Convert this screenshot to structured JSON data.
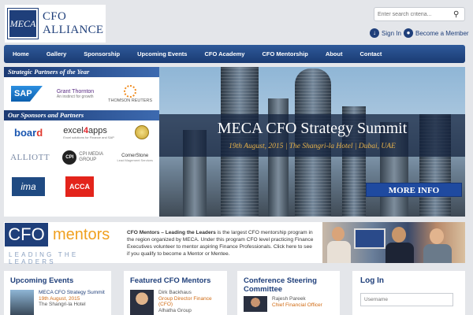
{
  "header": {
    "logo_mark": "MECA",
    "logo_line1": "CFO",
    "logo_line2": "ALLIANCE",
    "search_placeholder": "Enter search criteria...",
    "sign_in": "Sign In",
    "become_member": "Become a Member"
  },
  "nav": {
    "items": [
      "Home",
      "Gallery",
      "Sponsorship",
      "Upcoming Events",
      "CFO Academy",
      "CFO Mentorship",
      "About",
      "Contact"
    ]
  },
  "partners": {
    "strategic_heading": "Strategic Partners of the Year",
    "sponsors_heading": "Our Sponsors and Partners",
    "sap": "SAP",
    "grant_thornton": "Grant Thornton",
    "grant_thornton_tagline": "An instinct for growth",
    "thomson_reuters": "THOMSON REUTERS",
    "board_prefix": "boar",
    "board_suffix": "d",
    "excel_prefix": "excel",
    "excel_num": "4",
    "excel_suffix": "apps",
    "excel_tagline": "Excel solutions for Finance and SAP",
    "alliott": "ALLIOTT",
    "cpi_badge": "CPI",
    "cpi_text": "CPI MEDIA GROUP",
    "cornerstone": "CornerStone",
    "cornerstone_tagline": "Lead Magement Services",
    "ima": "ima",
    "acca": "ACCA"
  },
  "hero": {
    "title": "MECA CFO Strategy Summit",
    "subtitle": "19th August, 2015 | The Shangri-la Hotel | Dubai, UAE",
    "cta": "MORE INFO"
  },
  "mentors": {
    "logo_left": "CFO",
    "logo_right": "mentors",
    "tagline": "LEADING THE LEADERS",
    "text_bold": "CFO Mentors – Leading the Leaders",
    "text_body": " is the largest CFO mentorship program in the region organized by MECA. Under this program CFO level practicing Finance Executives volunteer to mentor aspiring Finance Professionals. Click here to see if you qualify to become a Mentor or Mentee."
  },
  "cards": {
    "events": {
      "title": "Upcoming Events",
      "item_title": "MECA CFO Strategy Summit",
      "item_date": "19th August, 2015",
      "item_place": "The Shangri-la Hotel"
    },
    "mentors": {
      "title": "Featured CFO Mentors",
      "name": "Dirk Backhaus",
      "role": "Group Director Finance (CFO)",
      "company": "Alhatha Group"
    },
    "committee": {
      "title": "Conference Steering Committee",
      "name": "Rajesh Pareek",
      "role": "Chief Financial Officer"
    },
    "login": {
      "title": "Log In",
      "username_placeholder": "Username"
    }
  },
  "colors": {
    "brand_navy": "#1f3f7a",
    "accent_orange": "#f0a020",
    "hero_date_gold": "#e7b24a"
  }
}
